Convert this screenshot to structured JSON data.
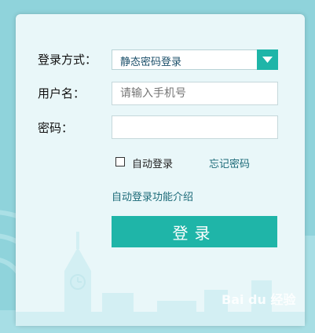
{
  "form": {
    "login_method_label": "登录方式：",
    "login_method_value": "静态密码登录",
    "username_label": "用户名：",
    "username_placeholder": "请输入手机号",
    "password_label": "密码：",
    "password_value": "",
    "auto_login_label": "自动登录",
    "auto_login_checked": false,
    "forgot_password_link": "忘记密码",
    "auto_login_intro_link": "自动登录功能介绍",
    "submit_label": "登录"
  },
  "watermark": {
    "text": "Bai du 经验"
  },
  "colors": {
    "accent": "#1fb5a8",
    "page_background": "#8fd3db",
    "card_background": "#e9f7f9",
    "link": "#1b6a78"
  },
  "icons": {
    "dropdown": "chevron-down-icon",
    "wifi": "wifi-signal-icon",
    "skyline": "city-skyline-illustration"
  }
}
